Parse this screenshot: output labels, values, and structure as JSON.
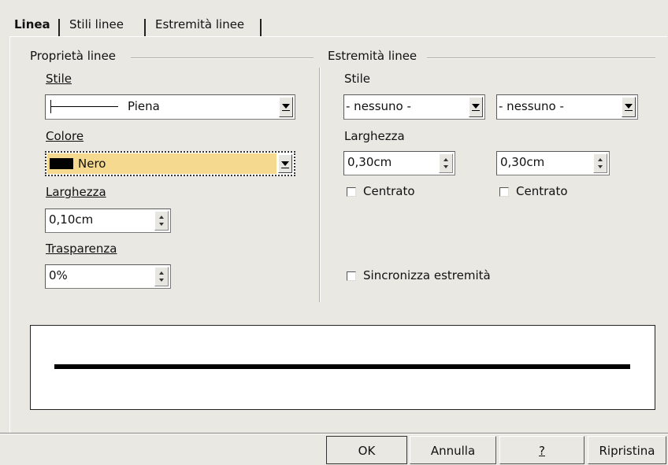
{
  "tabs": [
    {
      "label": "Linea",
      "active": true
    },
    {
      "label": "Stili linee",
      "active": false
    },
    {
      "label": "Estremità linee",
      "active": false
    }
  ],
  "line_properties": {
    "heading": "Proprietà linee",
    "style": {
      "label": "Stile",
      "value": "Piena"
    },
    "color": {
      "label": "Colore",
      "value": "Nero",
      "swatch": "#000000",
      "highlight": "#f4d98e"
    },
    "width": {
      "label": "Larghezza",
      "value": "0,10cm"
    },
    "transparency": {
      "label": "Trasparenza",
      "value": "0%"
    }
  },
  "line_ends": {
    "heading": "Estremità linee",
    "style_label": "Stile",
    "start_style": "- nessuno -",
    "end_style": "- nessuno -",
    "width_label": "Larghezza",
    "start_width": "0,30cm",
    "end_width": "0,30cm",
    "start_centered": {
      "label": "Centrato",
      "checked": false
    },
    "end_centered": {
      "label": "Centrato",
      "checked": false
    },
    "sync": {
      "label": "Sincronizza estremità",
      "checked": false
    }
  },
  "buttons": {
    "ok": "OK",
    "cancel": "Annulla",
    "help": "?",
    "reset": "Ripristina"
  }
}
